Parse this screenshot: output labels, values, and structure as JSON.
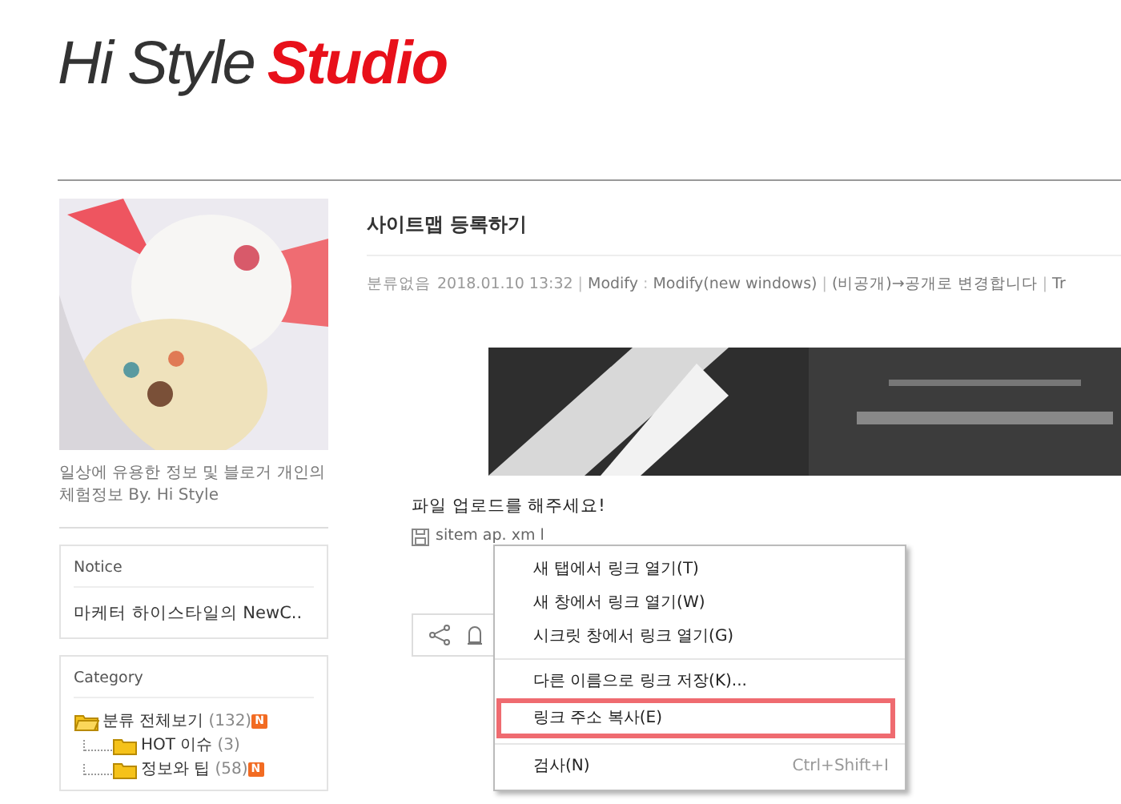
{
  "logo": {
    "first": "Hi Style",
    "second": "Studio"
  },
  "sidebar": {
    "description": "일상에 유용한 정보 및 블로거 개인의 체험정보 By. Hi Style",
    "notice": {
      "title": "Notice",
      "items": [
        "마케터 하이스타일의 NewC.."
      ]
    },
    "category": {
      "title": "Category",
      "root": {
        "label": "분류 전체보기",
        "count": "(132)",
        "badge": "N",
        "children": [
          {
            "label": "HOT 이슈",
            "count": "(3)"
          },
          {
            "label": "정보와 팁",
            "count": "(58)",
            "badge": "N"
          }
        ]
      }
    }
  },
  "post": {
    "title": "사이트맵 등록하기",
    "meta": [
      "분류없음",
      "2018.01.10 13:32",
      "|",
      "Modify",
      ":",
      "Modify(new windows)",
      "|",
      "(비공개)→공개로 변경합니다",
      "|",
      "Tr"
    ],
    "text": "파일 업로드를 해주세요!",
    "file": "sitem ap. xm l"
  },
  "context_menu": [
    {
      "label": "새 탭에서 링크 열기(T)",
      "selected": false
    },
    {
      "label": "새 창에서 링크 열기(W)",
      "selected": false
    },
    {
      "label": "시크릿 창에서 링크 열기(G)",
      "selected": false,
      "separator_after": true
    },
    {
      "label": "다른 이름으로 링크 저장(K)...",
      "selected": false
    },
    {
      "label": "링크 주소 복사(E)",
      "selected": true,
      "separator_after": true
    },
    {
      "label": "검사(N)",
      "shortcut": "Ctrl+Shift+I",
      "selected": false
    }
  ]
}
